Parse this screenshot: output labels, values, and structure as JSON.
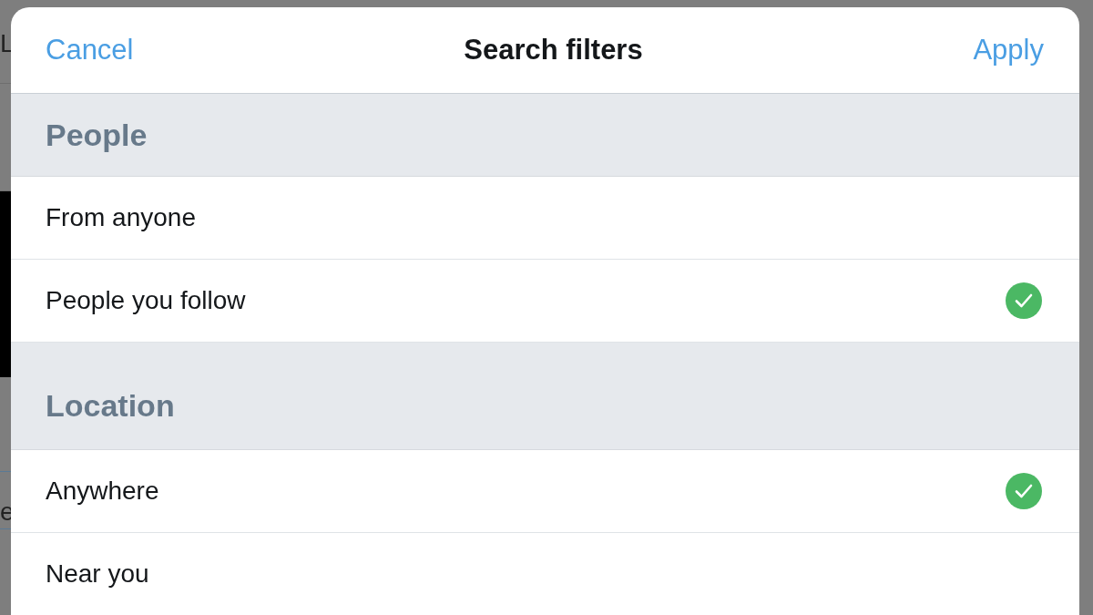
{
  "background": {
    "texts": [
      "L",
      "e"
    ]
  },
  "dialog": {
    "title": "Search filters",
    "cancel": "Cancel",
    "apply": "Apply"
  },
  "sections": [
    {
      "heading": "People",
      "options": [
        {
          "label": "From anyone",
          "selected": false
        },
        {
          "label": "People you follow",
          "selected": true
        }
      ]
    },
    {
      "heading": "Location",
      "options": [
        {
          "label": "Anywhere",
          "selected": true
        },
        {
          "label": "Near you",
          "selected": false
        }
      ]
    }
  ]
}
